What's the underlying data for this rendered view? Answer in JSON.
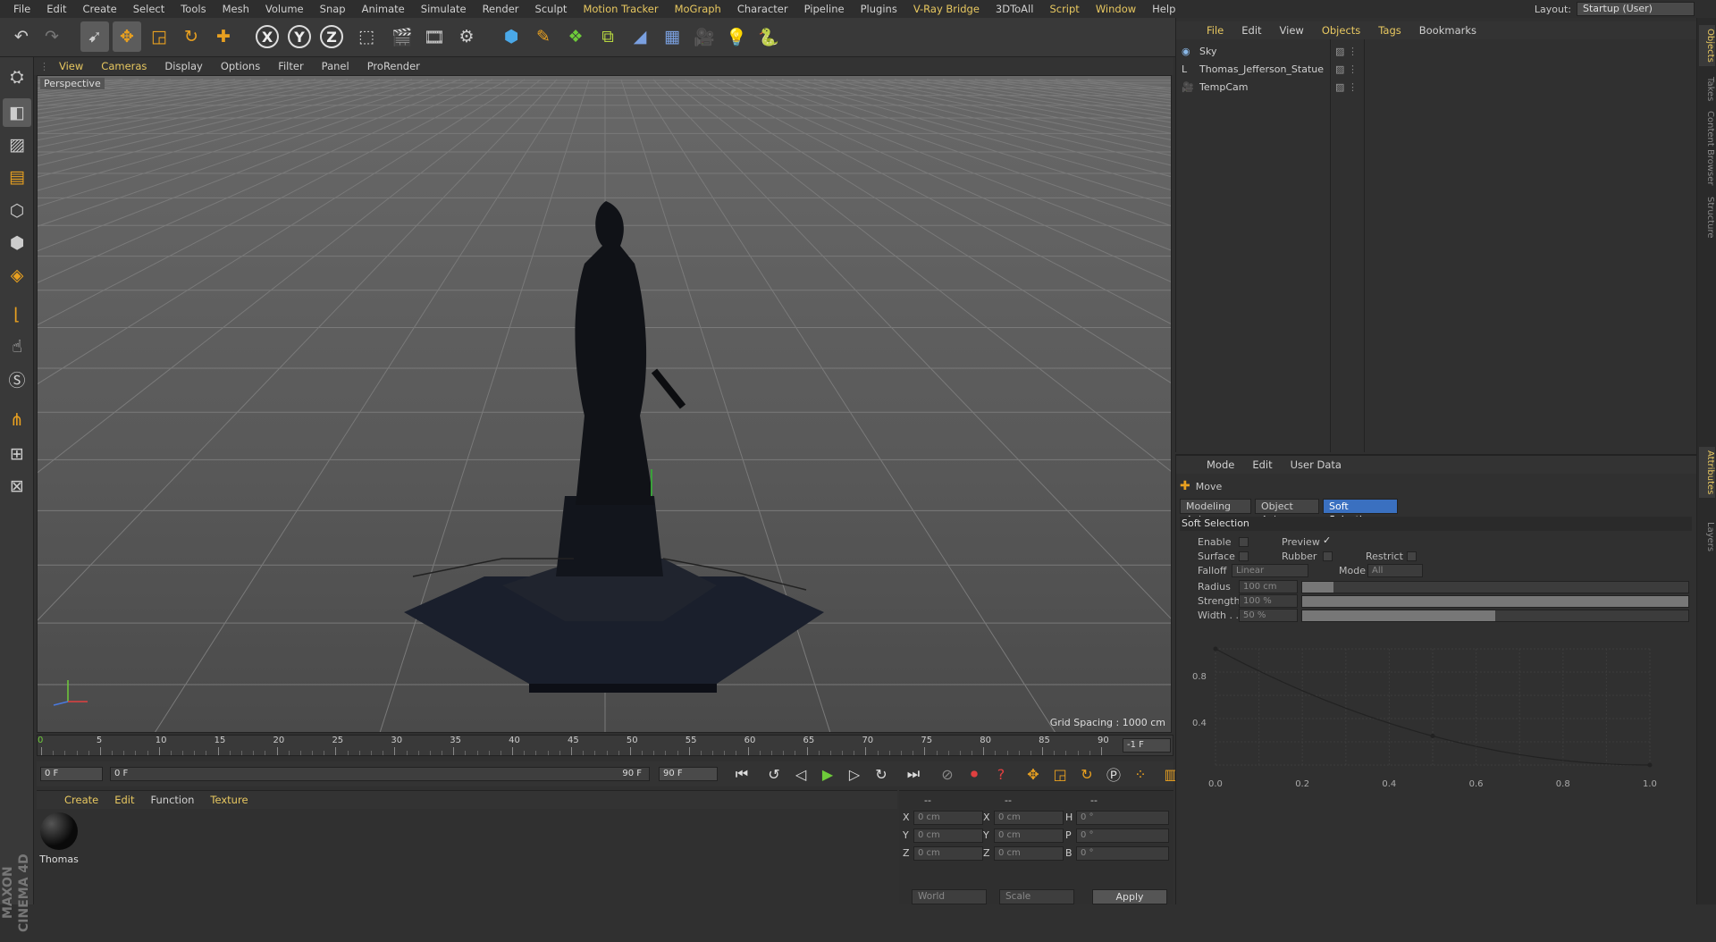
{
  "menubar": {
    "items": [
      {
        "label": "File",
        "hl": false
      },
      {
        "label": "Edit",
        "hl": false
      },
      {
        "label": "Create",
        "hl": false
      },
      {
        "label": "Select",
        "hl": false
      },
      {
        "label": "Tools",
        "hl": false
      },
      {
        "label": "Mesh",
        "hl": false
      },
      {
        "label": "Volume",
        "hl": false
      },
      {
        "label": "Snap",
        "hl": false
      },
      {
        "label": "Animate",
        "hl": false
      },
      {
        "label": "Simulate",
        "hl": false
      },
      {
        "label": "Render",
        "hl": false
      },
      {
        "label": "Sculpt",
        "hl": false
      },
      {
        "label": "Motion Tracker",
        "hl": true
      },
      {
        "label": "MoGraph",
        "hl": true
      },
      {
        "label": "Character",
        "hl": false
      },
      {
        "label": "Pipeline",
        "hl": false
      },
      {
        "label": "Plugins",
        "hl": false
      },
      {
        "label": "V-Ray Bridge",
        "hl": true
      },
      {
        "label": "3DToAll",
        "hl": false
      },
      {
        "label": "Script",
        "hl": true
      },
      {
        "label": "Window",
        "hl": true
      },
      {
        "label": "Help",
        "hl": false
      }
    ],
    "layout_label": "Layout:",
    "layout_value": "Startup (User)"
  },
  "viewport": {
    "menu": [
      {
        "label": "View",
        "hl": true
      },
      {
        "label": "Cameras",
        "hl": true
      },
      {
        "label": "Display",
        "hl": false
      },
      {
        "label": "Options",
        "hl": false
      },
      {
        "label": "Filter",
        "hl": false
      },
      {
        "label": "Panel",
        "hl": false
      },
      {
        "label": "ProRender",
        "hl": false
      }
    ],
    "camera_label": "Perspective",
    "grid_spacing": "Grid Spacing : 1000 cm"
  },
  "timeline": {
    "ticks": [
      "0",
      "5",
      "10",
      "15",
      "20",
      "25",
      "30",
      "35",
      "40",
      "45",
      "50",
      "55",
      "60",
      "65",
      "70",
      "75",
      "80",
      "85",
      "90"
    ],
    "end_field": "-1 F"
  },
  "transport": {
    "start_field": "0 F",
    "range_start": "0 F",
    "range_end": "90 F",
    "end_field": "90 F"
  },
  "material_manager": {
    "menu": [
      {
        "label": "Create",
        "hl": true
      },
      {
        "label": "Edit",
        "hl": true
      },
      {
        "label": "Function",
        "hl": false
      },
      {
        "label": "Texture",
        "hl": true
      }
    ],
    "material_name": "Thomas"
  },
  "coordinates": {
    "header": [
      "--",
      "--",
      "--"
    ],
    "rows": [
      {
        "a": "X",
        "av": "0 cm",
        "b": "X",
        "bv": "0 cm",
        "c": "H",
        "cv": "0 °"
      },
      {
        "a": "Y",
        "av": "0 cm",
        "b": "Y",
        "bv": "0 cm",
        "c": "P",
        "cv": "0 °"
      },
      {
        "a": "Z",
        "av": "0 cm",
        "b": "Z",
        "bv": "0 cm",
        "c": "B",
        "cv": "0 °"
      }
    ],
    "world": "World",
    "scale": "Scale",
    "apply": "Apply"
  },
  "object_manager": {
    "menu": [
      {
        "label": "File",
        "hl": true
      },
      {
        "label": "Edit",
        "hl": false
      },
      {
        "label": "View",
        "hl": false
      },
      {
        "label": "Objects",
        "hl": true
      },
      {
        "label": "Tags",
        "hl": true
      },
      {
        "label": "Bookmarks",
        "hl": false
      }
    ],
    "objects": [
      {
        "name": "Sky",
        "icon": "sky-icon"
      },
      {
        "name": "Thomas_Jefferson_Statue",
        "icon": "null-object-icon"
      },
      {
        "name": "TempCam",
        "icon": "camera-icon"
      }
    ]
  },
  "attributes": {
    "menu": [
      "Mode",
      "Edit",
      "User Data"
    ],
    "tool_name": "Move",
    "tabs": [
      {
        "label": "Modeling Axis",
        "active": false
      },
      {
        "label": "Object Axis",
        "active": false
      },
      {
        "label": "Soft Selection",
        "active": true
      }
    ],
    "section": "Soft Selection",
    "enable": "Enable",
    "preview": "Preview",
    "surface": "Surface",
    "rubber": "Rubber",
    "restrict": "Restrict",
    "falloff": "Falloff",
    "falloff_value": "Linear",
    "mode": "Mode",
    "mode_value": "All",
    "radius": "Radius",
    "radius_value": "100 cm",
    "radius_fill": 0.08,
    "strength": "Strength",
    "strength_value": "100 %",
    "strength_fill": 1.0,
    "width": "Width . .",
    "width_value": "50 %",
    "width_fill": 0.5,
    "curve_y_labels": [
      "0.8",
      "0.4"
    ],
    "curve_x_labels": [
      "0.0",
      "0.2",
      "0.4",
      "0.6",
      "0.8",
      "1.0"
    ]
  },
  "right_tabs": [
    {
      "label": "Objects",
      "active": true
    },
    {
      "label": "Takes",
      "active": false
    },
    {
      "label": "Content Browser",
      "active": false
    },
    {
      "label": "Structure",
      "active": false
    },
    {
      "label": "Attributes",
      "active": true
    },
    {
      "label": "Layers",
      "active": false
    }
  ]
}
